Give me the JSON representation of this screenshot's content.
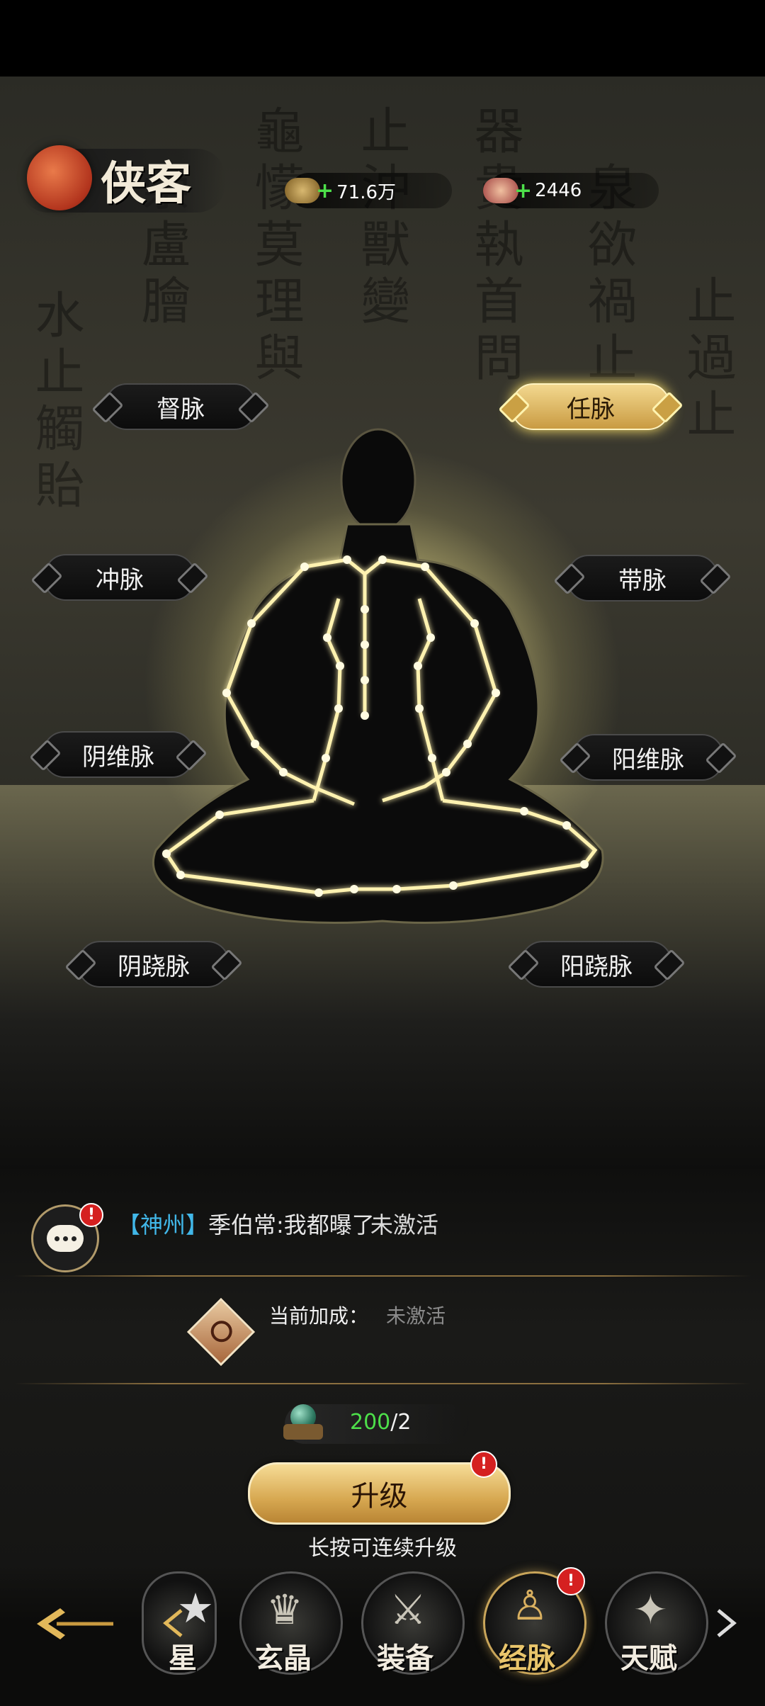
{
  "header": {
    "title": "侠客",
    "currencies": [
      {
        "icon": "coin-stack-icon",
        "value": "71.6万"
      },
      {
        "icon": "ingot-icon",
        "value": "2446"
      }
    ]
  },
  "meridians": [
    {
      "id": "du",
      "label": "督脉",
      "active": false
    },
    {
      "id": "ren",
      "label": "任脉",
      "active": true
    },
    {
      "id": "chong",
      "label": "冲脉",
      "active": false
    },
    {
      "id": "dai",
      "label": "带脉",
      "active": false
    },
    {
      "id": "yinwei",
      "label": "阴维脉",
      "active": false
    },
    {
      "id": "yangwei",
      "label": "阳维脉",
      "active": false
    },
    {
      "id": "yinqiao",
      "label": "阴跷脉",
      "active": false
    },
    {
      "id": "yangqiao",
      "label": "阳跷脉",
      "active": false
    }
  ],
  "chat": {
    "channel": "【神州】",
    "message": "季伯常:我都曝了",
    "overlay": "未激活",
    "badge": "!"
  },
  "bonus": {
    "label": "当前加成：",
    "value": "未激活"
  },
  "cost": {
    "have": "200",
    "need": "/2"
  },
  "upgrade": {
    "label": "升级",
    "badge": "!",
    "hint": "长按可连续升级"
  },
  "nav": {
    "tabs": [
      {
        "label": "星",
        "icon": "star-icon",
        "active": false
      },
      {
        "label": "玄晶",
        "icon": "crystal-icon",
        "active": false
      },
      {
        "label": "装备",
        "icon": "crossed-swords-icon",
        "active": false
      },
      {
        "label": "经脉",
        "icon": "meridian-body-icon",
        "active": true
      },
      {
        "label": "天赋",
        "icon": "talent-orb-icon",
        "active": false
      }
    ],
    "badge": "!"
  },
  "colors": {
    "gold": "#d7a851",
    "green": "#4de04a",
    "chat_channel": "#41b7e8",
    "badge_red": "#d52020"
  }
}
